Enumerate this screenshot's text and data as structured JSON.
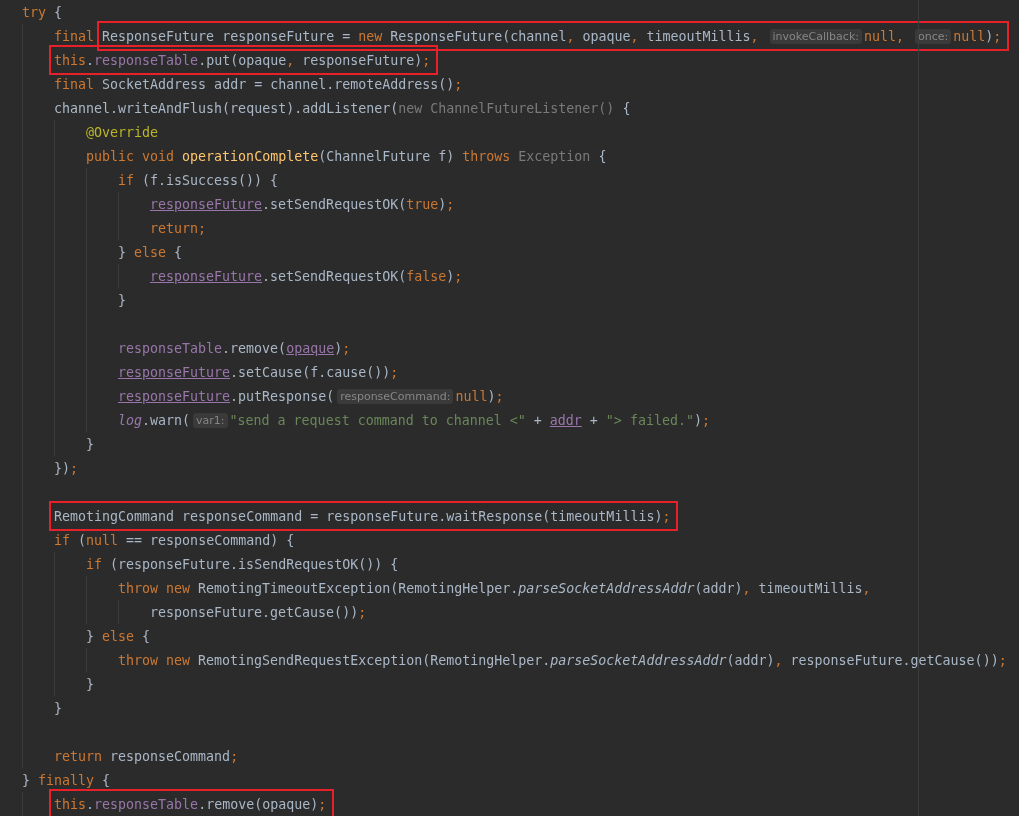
{
  "editor": {
    "lines": [
      {
        "kind": "code",
        "tokens": [
          {
            "text": "try ",
            "kind": "kw"
          },
          {
            "text": "{",
            "kind": "txt"
          }
        ],
        "children": [
          {
            "kind": "code",
            "pre": [
              {
                "text": "final ",
                "kind": "kw"
              }
            ],
            "boxed": true,
            "tokens": [
              {
                "text": "ResponseFuture responseFuture = ",
                "kind": "txt"
              },
              {
                "text": "new ",
                "kind": "kw"
              },
              {
                "text": "ResponseFuture(channel",
                "kind": "txt"
              },
              {
                "text": ", ",
                "kind": "kw"
              },
              {
                "text": "opaque",
                "kind": "txt"
              },
              {
                "text": ", ",
                "kind": "kw"
              },
              {
                "text": "timeoutMillis",
                "kind": "txt"
              },
              {
                "text": ", ",
                "kind": "kw"
              },
              {
                "text": "invokeCallback:",
                "kind": "hint"
              },
              {
                "text": "null, ",
                "kind": "kw"
              },
              {
                "text": "once:",
                "kind": "hint"
              },
              {
                "text": "null",
                "kind": "kw"
              },
              {
                "text": ")",
                "kind": "txt"
              },
              {
                "text": ";",
                "kind": "kw"
              }
            ]
          },
          {
            "kind": "code",
            "boxed": true,
            "tokens": [
              {
                "text": "this",
                "kind": "kw"
              },
              {
                "text": ".",
                "kind": "txt"
              },
              {
                "text": "responseTable",
                "kind": "fld"
              },
              {
                "text": ".put(opaque",
                "kind": "txt"
              },
              {
                "text": ", ",
                "kind": "kw"
              },
              {
                "text": "responseFuture)",
                "kind": "txt"
              },
              {
                "text": ";",
                "kind": "kw"
              }
            ]
          },
          {
            "kind": "code",
            "boxed": false,
            "tokens": [
              {
                "text": "final ",
                "kind": "kw"
              },
              {
                "text": "SocketAddress addr = channel.remoteAddress()",
                "kind": "txt"
              },
              {
                "text": ";",
                "kind": "kw"
              }
            ]
          },
          {
            "kind": "code",
            "tokens": [
              {
                "text": "channel.writeAndFlush(request).addListener(",
                "kind": "txt"
              },
              {
                "text": "new ChannelFutureListener() ",
                "kind": "dim"
              },
              {
                "text": "{",
                "kind": "txt"
              }
            ],
            "children": [
              {
                "kind": "code",
                "tokens": [
                  {
                    "text": "@Override",
                    "kind": "ann"
                  }
                ]
              },
              {
                "kind": "code",
                "tokens": [
                  {
                    "text": "public void ",
                    "kind": "kw"
                  },
                  {
                    "text": "operationComplete",
                    "kind": "decl"
                  },
                  {
                    "text": "(ChannelFuture f) ",
                    "kind": "txt"
                  },
                  {
                    "text": "throws ",
                    "kind": "kw"
                  },
                  {
                    "text": "Exception ",
                    "kind": "dim"
                  },
                  {
                    "text": "{",
                    "kind": "txt"
                  }
                ],
                "children": [
                  {
                    "kind": "code",
                    "tokens": [
                      {
                        "text": "if ",
                        "kind": "kw"
                      },
                      {
                        "text": "(f.isSuccess()) {",
                        "kind": "txt"
                      }
                    ],
                    "children": [
                      {
                        "kind": "code",
                        "tokens": [
                          {
                            "text": "responseFuture",
                            "kind": "fldu"
                          },
                          {
                            "text": ".setSendRequestOK(",
                            "kind": "txt"
                          },
                          {
                            "text": "true",
                            "kind": "kw"
                          },
                          {
                            "text": ")",
                            "kind": "txt"
                          },
                          {
                            "text": ";",
                            "kind": "kw"
                          }
                        ]
                      },
                      {
                        "kind": "code",
                        "tokens": [
                          {
                            "text": "return;",
                            "kind": "kw"
                          }
                        ]
                      }
                    ]
                  },
                  {
                    "kind": "code",
                    "tokens": [
                      {
                        "text": "} ",
                        "kind": "txt"
                      },
                      {
                        "text": "else ",
                        "kind": "kw"
                      },
                      {
                        "text": "{",
                        "kind": "txt"
                      }
                    ],
                    "children": [
                      {
                        "kind": "code",
                        "tokens": [
                          {
                            "text": "responseFuture",
                            "kind": "fldu"
                          },
                          {
                            "text": ".setSendRequestOK(",
                            "kind": "txt"
                          },
                          {
                            "text": "false",
                            "kind": "kw"
                          },
                          {
                            "text": ")",
                            "kind": "txt"
                          },
                          {
                            "text": ";",
                            "kind": "kw"
                          }
                        ]
                      }
                    ]
                  },
                  {
                    "kind": "code",
                    "tokens": [
                      {
                        "text": "}",
                        "kind": "txt"
                      }
                    ]
                  },
                  {
                    "kind": "blank"
                  },
                  {
                    "kind": "code",
                    "tokens": [
                      {
                        "text": "responseTable",
                        "kind": "fld"
                      },
                      {
                        "text": ".remove(",
                        "kind": "txt"
                      },
                      {
                        "text": "opaque",
                        "kind": "fldu"
                      },
                      {
                        "text": ")",
                        "kind": "txt"
                      },
                      {
                        "text": ";",
                        "kind": "kw"
                      }
                    ]
                  },
                  {
                    "kind": "code",
                    "tokens": [
                      {
                        "text": "responseFuture",
                        "kind": "fldu"
                      },
                      {
                        "text": ".setCause(f.cause())",
                        "kind": "txt"
                      },
                      {
                        "text": ";",
                        "kind": "kw"
                      }
                    ]
                  },
                  {
                    "kind": "code",
                    "tokens": [
                      {
                        "text": "responseFuture",
                        "kind": "fldu"
                      },
                      {
                        "text": ".putResponse(",
                        "kind": "txt"
                      },
                      {
                        "text": "responseCommand:",
                        "kind": "hint"
                      },
                      {
                        "text": "null",
                        "kind": "kw"
                      },
                      {
                        "text": ")",
                        "kind": "txt"
                      },
                      {
                        "text": ";",
                        "kind": "kw"
                      }
                    ]
                  },
                  {
                    "kind": "code",
                    "tokens": [
                      {
                        "text": "log",
                        "kind": "fldi"
                      },
                      {
                        "text": ".warn(",
                        "kind": "txt"
                      },
                      {
                        "text": "var1:",
                        "kind": "hint"
                      },
                      {
                        "text": "\"send a request command to channel <\" ",
                        "kind": "str"
                      },
                      {
                        "text": "+ ",
                        "kind": "txt"
                      },
                      {
                        "text": "addr",
                        "kind": "fldu"
                      },
                      {
                        "text": " + ",
                        "kind": "txt"
                      },
                      {
                        "text": "\"> failed.\"",
                        "kind": "str"
                      },
                      {
                        "text": ")",
                        "kind": "txt"
                      },
                      {
                        "text": ";",
                        "kind": "kw"
                      }
                    ]
                  }
                ]
              },
              {
                "kind": "code",
                "tokens": [
                  {
                    "text": "}",
                    "kind": "txt"
                  }
                ]
              }
            ]
          },
          {
            "kind": "code",
            "tokens": [
              {
                "text": "})",
                "kind": "txt"
              },
              {
                "text": ";",
                "kind": "kw"
              }
            ]
          },
          {
            "kind": "blank"
          },
          {
            "kind": "code",
            "boxed": true,
            "tokens": [
              {
                "text": "RemotingCommand responseCommand = responseFuture.waitResponse(timeoutMillis)",
                "kind": "txt"
              },
              {
                "text": ";",
                "kind": "kw"
              }
            ]
          },
          {
            "kind": "code",
            "tokens": [
              {
                "text": "if ",
                "kind": "kw"
              },
              {
                "text": "(",
                "kind": "txt"
              },
              {
                "text": "null ",
                "kind": "kw"
              },
              {
                "text": "== responseCommand) {",
                "kind": "txt"
              }
            ],
            "children": [
              {
                "kind": "code",
                "tokens": [
                  {
                    "text": "if ",
                    "kind": "kw"
                  },
                  {
                    "text": "(responseFuture.isSendRequestOK()) {",
                    "kind": "txt"
                  }
                ],
                "children": [
                  {
                    "kind": "code",
                    "tokens": [
                      {
                        "text": "throw new ",
                        "kind": "kw"
                      },
                      {
                        "text": "RemotingTimeoutException(RemotingHelper.",
                        "kind": "txt"
                      },
                      {
                        "text": "parseSocketAddressAddr",
                        "kind": "ital"
                      },
                      {
                        "text": "(addr)",
                        "kind": "txt"
                      },
                      {
                        "text": ", ",
                        "kind": "kw"
                      },
                      {
                        "text": "timeoutMillis",
                        "kind": "txt"
                      },
                      {
                        "text": ",",
                        "kind": "kw"
                      }
                    ],
                    "children": [
                      {
                        "kind": "code",
                        "tokens": [
                          {
                            "text": "responseFuture.getCause())",
                            "kind": "txt"
                          },
                          {
                            "text": ";",
                            "kind": "kw"
                          }
                        ]
                      }
                    ]
                  }
                ]
              },
              {
                "kind": "code",
                "tokens": [
                  {
                    "text": "} ",
                    "kind": "txt"
                  },
                  {
                    "text": "else ",
                    "kind": "kw"
                  },
                  {
                    "text": "{",
                    "kind": "txt"
                  }
                ],
                "children": [
                  {
                    "kind": "code",
                    "tokens": [
                      {
                        "text": "throw new ",
                        "kind": "kw"
                      },
                      {
                        "text": "RemotingSendRequestException(RemotingHelper.",
                        "kind": "txt"
                      },
                      {
                        "text": "parseSocketAddressAddr",
                        "kind": "ital"
                      },
                      {
                        "text": "(addr)",
                        "kind": "txt"
                      },
                      {
                        "text": ", ",
                        "kind": "kw"
                      },
                      {
                        "text": "responseFuture.getCause())",
                        "kind": "txt"
                      },
                      {
                        "text": ";",
                        "kind": "kw"
                      }
                    ]
                  }
                ]
              },
              {
                "kind": "code",
                "tokens": [
                  {
                    "text": "}",
                    "kind": "txt"
                  }
                ]
              }
            ]
          },
          {
            "kind": "code",
            "tokens": [
              {
                "text": "}",
                "kind": "txt"
              }
            ]
          },
          {
            "kind": "blank"
          },
          {
            "kind": "code",
            "tokens": [
              {
                "text": "return ",
                "kind": "kw"
              },
              {
                "text": "responseCommand",
                "kind": "txt"
              },
              {
                "text": ";",
                "kind": "kw"
              }
            ]
          }
        ]
      },
      {
        "kind": "code",
        "tokens": [
          {
            "text": "} ",
            "kind": "txt"
          },
          {
            "text": "finally ",
            "kind": "kw"
          },
          {
            "text": "{",
            "kind": "txt"
          }
        ],
        "children": [
          {
            "kind": "code",
            "boxed": true,
            "tokens": [
              {
                "text": "this",
                "kind": "kw"
              },
              {
                "text": ".",
                "kind": "txt"
              },
              {
                "text": "responseTable",
                "kind": "fld"
              },
              {
                "text": ".remove(opaque)",
                "kind": "txt"
              },
              {
                "text": ";",
                "kind": "kw"
              }
            ]
          }
        ]
      }
    ]
  }
}
